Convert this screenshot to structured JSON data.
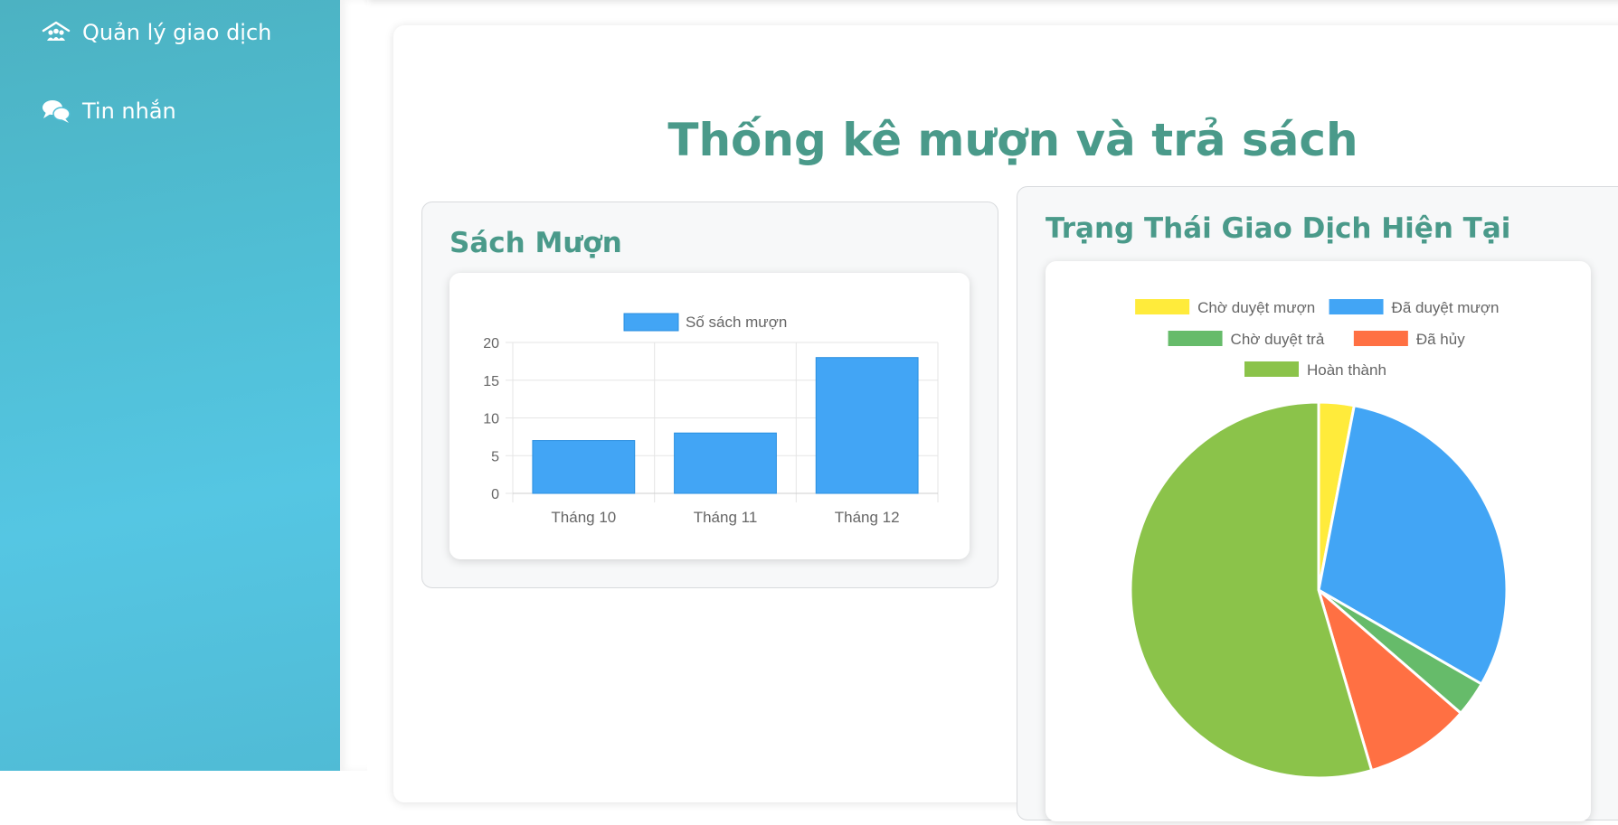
{
  "sidebar": {
    "items": [
      {
        "label": "Quản lý giao dịch",
        "icon": "house-users-icon"
      },
      {
        "label": "Tin nhắn",
        "icon": "comments-icon"
      }
    ]
  },
  "page": {
    "title": "Thống kê mượn và trả sách"
  },
  "borrow_panel": {
    "title": "Sách Mượn"
  },
  "status_panel": {
    "title": "Trạng Thái Giao Dịch Hiện Tại"
  },
  "colors": {
    "accent": "#4a9a8a",
    "bar": "#42a5f5"
  },
  "chart_data": [
    {
      "type": "bar",
      "categories": [
        "Tháng 10",
        "Tháng 11",
        "Tháng 12"
      ],
      "series": [
        {
          "name": "Số sách mượn",
          "values": [
            7,
            8,
            18
          ],
          "color": "#42a5f5"
        }
      ],
      "ylim": [
        0,
        20
      ],
      "yticks": [
        0,
        5,
        10,
        15,
        20
      ],
      "legend": "top",
      "grid": true
    },
    {
      "type": "pie",
      "labels": [
        "Chờ duyệt mượn",
        "Đã duyệt mượn",
        "Chờ duyệt trả",
        "Đã hủy",
        "Hoàn thành"
      ],
      "values": [
        1,
        10,
        1,
        3,
        18
      ],
      "colors": [
        "#ffeb3b",
        "#42a5f5",
        "#66bb6a",
        "#ff7043",
        "#8bc34a"
      ],
      "legend": "top"
    }
  ]
}
